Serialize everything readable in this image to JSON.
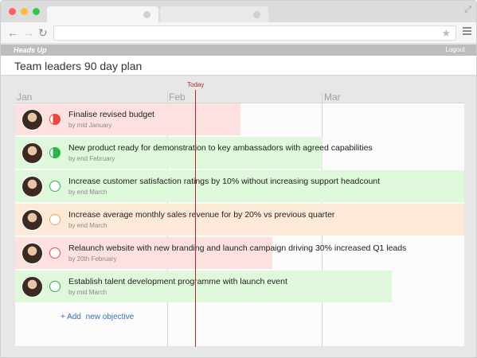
{
  "browser": {
    "tabs": [
      {
        "label": ""
      },
      {
        "label": ""
      }
    ],
    "address": "",
    "icons": {
      "back": "back-arrow-icon",
      "forward": "forward-arrow-icon",
      "reload": "reload-icon",
      "bookmark": "star-icon",
      "menu": "hamburger-menu-icon",
      "expand": "expand-icon"
    }
  },
  "app": {
    "brand": "Heads Up",
    "logout": "Logout",
    "title": "Team leaders 90 day plan"
  },
  "timeline": {
    "months": [
      "Jan",
      "Feb",
      "Mar"
    ],
    "today_label": "Today"
  },
  "objectives": [
    {
      "title": "Finalise revised budget",
      "due": "by mid January",
      "status": "red",
      "status_fill": "half",
      "bar_color": "#fde0e0",
      "span_end": "Feb mid"
    },
    {
      "title": "New product ready for demonstration to key ambassadors with agreed capabilities",
      "due": "by end February",
      "status": "green",
      "status_fill": "half",
      "bar_color": "#dff7da",
      "span_end": "Mar start"
    },
    {
      "title": "Increase customer satisfaction ratings by 10% without increasing support headcount",
      "due": "by end March",
      "status": "green",
      "status_fill": "empty",
      "bar_color": "#dff7da",
      "span_end": "Mar end"
    },
    {
      "title": "Increase average monthly sales revenue for by 20% vs previous quarter",
      "due": "by end March",
      "status": "orange",
      "status_fill": "empty",
      "bar_color": "#fde9d8",
      "span_end": "Mar end"
    },
    {
      "title": "Relaunch website with new branding and launch campaign driving 30% increased Q1 leads",
      "due": "by 20th February",
      "status": "red",
      "status_fill": "empty",
      "bar_color": "#fde0e0",
      "span_end": "Feb late"
    },
    {
      "title": "Establish talent development programme with launch event",
      "due": "by mid March",
      "status": "green",
      "status_fill": "empty",
      "bar_color": "#dff7da",
      "span_end": "Mar mid"
    }
  ],
  "add": {
    "link": "+ Add",
    "text": "new objective"
  },
  "colors": {
    "red": "#e84a3f",
    "green": "#2bb24c",
    "orange": "#f0a35a",
    "today": "#b22a22"
  }
}
